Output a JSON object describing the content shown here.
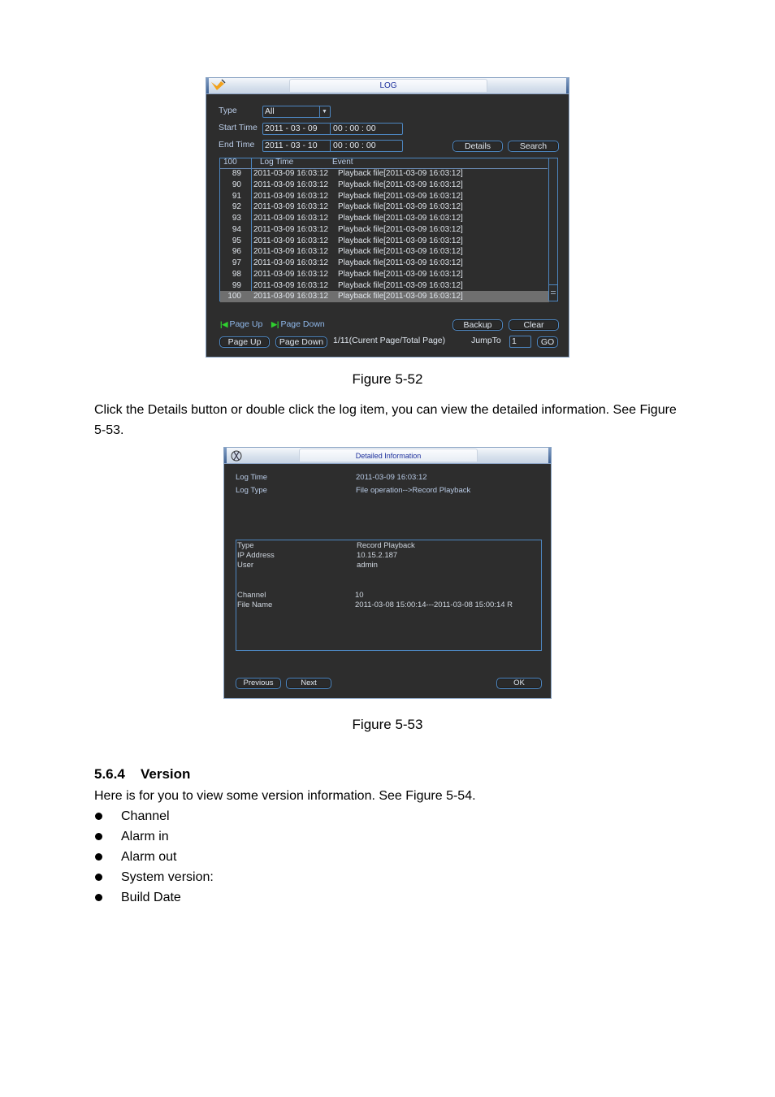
{
  "log_window": {
    "title": "LOG",
    "type_label": "Type",
    "type_value": "All",
    "start_time_label": "Start Time",
    "start_date": "2011  - 03 - 09",
    "start_clock": "00 :  00 :  00",
    "end_time_label": "End Time",
    "end_date": "2011  - 03 - 10",
    "end_clock": "00 :  00 :  00",
    "details_button": "Details",
    "search_button": "Search",
    "list_headers": {
      "count": "100",
      "log_time": "Log Time",
      "event": "Event"
    },
    "rows": [
      {
        "no": "89",
        "time": "2011-03-09 16:03:12",
        "event": "Playback file[2011-03-09 16:03:12]"
      },
      {
        "no": "90",
        "time": "2011-03-09 16:03:12",
        "event": "Playback file[2011-03-09 16:03:12]"
      },
      {
        "no": "91",
        "time": "2011-03-09 16:03:12",
        "event": "Playback file[2011-03-09 16:03:12]"
      },
      {
        "no": "92",
        "time": "2011-03-09 16:03:12",
        "event": "Playback file[2011-03-09 16:03:12]"
      },
      {
        "no": "93",
        "time": "2011-03-09 16:03:12",
        "event": "Playback file[2011-03-09 16:03:12]"
      },
      {
        "no": "94",
        "time": "2011-03-09 16:03:12",
        "event": "Playback file[2011-03-09 16:03:12]"
      },
      {
        "no": "95",
        "time": "2011-03-09 16:03:12",
        "event": "Playback file[2011-03-09 16:03:12]"
      },
      {
        "no": "96",
        "time": "2011-03-09 16:03:12",
        "event": "Playback file[2011-03-09 16:03:12]"
      },
      {
        "no": "97",
        "time": "2011-03-09 16:03:12",
        "event": "Playback file[2011-03-09 16:03:12]"
      },
      {
        "no": "98",
        "time": "2011-03-09 16:03:12",
        "event": "Playback file[2011-03-09 16:03:12]"
      },
      {
        "no": "99",
        "time": "2011-03-09 16:03:12",
        "event": "Playback file[2011-03-09 16:03:12]"
      },
      {
        "no": "100",
        "time": "2011-03-09 16:03:12",
        "event": "Playback file[2011-03-09 16:03:12]",
        "selected": true
      }
    ],
    "hint_page_up": "Page Up",
    "hint_page_down": "Page Down",
    "backup_button": "Backup",
    "clear_button": "Clear",
    "page_up_button": "Page Up",
    "page_down_button": "Page Down",
    "page_info": "1/11(Curent Page/Total Page)",
    "jump_to_label": "JumpTo",
    "jump_to_value": "1",
    "go_button": "GO"
  },
  "detail_window": {
    "title": "Detailed Information",
    "log_time_label": "Log Time",
    "log_time_value": "2011-03-09 16:03:12",
    "log_type_label": "Log Type",
    "log_type_value": "File operation-->Record Playback",
    "type_label": "Type",
    "type_value": "Record Playback",
    "ip_label": "IP Address",
    "ip_value": "10.15.2.187",
    "user_label": "User",
    "user_value": "admin",
    "channel_label": "Channel",
    "channel_value": "10",
    "file_name_label": "File Name",
    "file_name_value": "2011-03-08 15:00:14---2011-03-08 15:00:14 R",
    "previous_button": "Previous",
    "next_button": "Next",
    "ok_button": "OK"
  },
  "document": {
    "caption_1": "Figure 5-52",
    "paragraph_1": "Click the Details button or double click the log item, you can view the detailed information. See Figure 5-53.",
    "caption_2": "Figure 5-53",
    "section_number": "5.6.4",
    "section_title": "Version",
    "paragraph_2": "Here is for you to view some version information. See Figure 5-54.",
    "bullets": [
      " Channel",
      "Alarm in",
      "Alarm out",
      "System version:",
      "Build Date"
    ]
  }
}
